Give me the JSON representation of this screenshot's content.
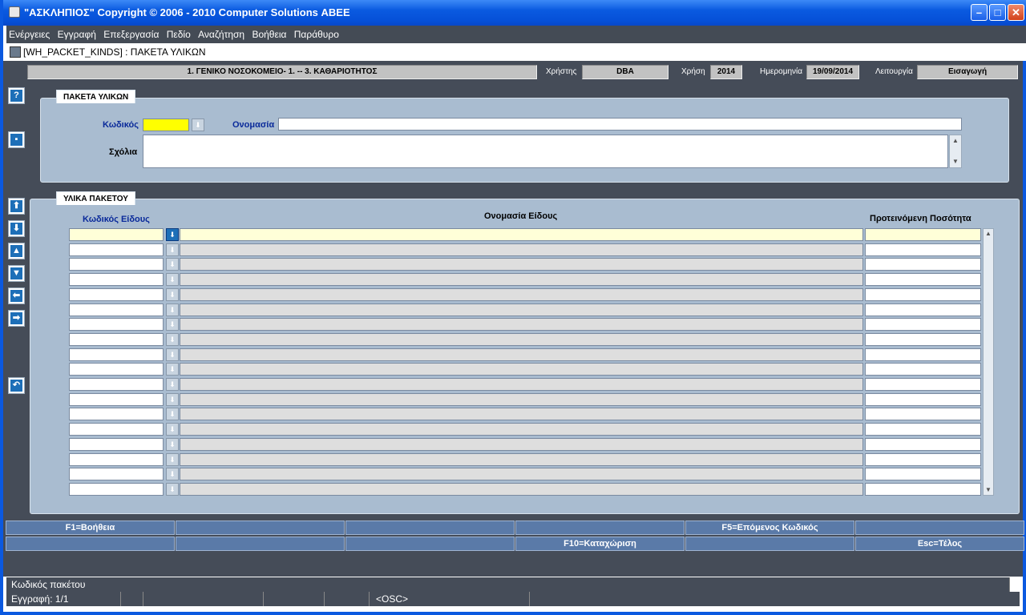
{
  "window": {
    "title": "\"ΑΣΚΛΗΠΙΟΣ\" Copyright © 2006 - 2010 Computer Solutions ΑΒΕΕ"
  },
  "menu": [
    "Ενέργειες",
    "Εγγραφή",
    "Επεξεργασία",
    "Πεδίο",
    "Αναζήτηση",
    "Βοήθεια",
    "Παράθυρο"
  ],
  "form": {
    "title": "[WH_PACKET_KINDS]   :   ΠΑΚΕΤΑ ΥΛΙΚΩΝ"
  },
  "header": {
    "org": "1. ΓΕΝΙΚΟ ΝΟΣΟΚΟΜΕΙΟ- 1. -- 3. ΚΑΘΑΡΙΟΤΗΤΟΣ",
    "user_label": "Χρήστης",
    "user": "DBA",
    "year_label": "Χρήση",
    "year": "2014",
    "date_label": "Ημερομηνία",
    "date": "19/09/2014",
    "mode_label": "Λειτουργία",
    "mode": "Εισαγωγή"
  },
  "packet_panel": {
    "title": "ΠΑΚΕΤΑ ΥΛΙΚΩΝ",
    "code_label": "Κωδικός",
    "code": "",
    "name_label": "Ονομασία",
    "name": "",
    "comments_label": "Σχόλια",
    "comments": ""
  },
  "items_panel": {
    "title": "ΥΛΙΚΑ ΠΑΚΕΤΟΥ",
    "col_code": "Κωδικός Είδους",
    "col_name": "Ονομασία Είδους",
    "col_qty": "Προτεινόμενη Ποσότητα",
    "row_count": 18
  },
  "fkeys_row1": [
    "F1=Βοήθεια",
    "",
    "",
    "",
    "F5=Επόμενος Κωδικός",
    ""
  ],
  "fkeys_row2": [
    "",
    "",
    "",
    "F10=Καταχώριση",
    "",
    "Esc=Τέλος"
  ],
  "status": {
    "hint": "Κωδικός πακέτου",
    "record": "Εγγραφή: 1/1",
    "osc": "<OSC>"
  }
}
